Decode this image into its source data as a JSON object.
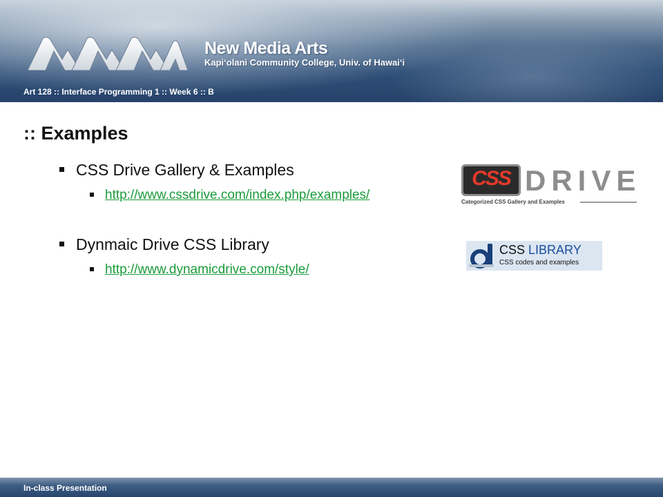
{
  "header": {
    "brand_title": "New Media Arts",
    "brand_subtitle": "Kapi‘olani Community College, Univ. of Hawai‘i",
    "course_line": "Art 128 :: Interface Programming 1 :: Week 6 :: B"
  },
  "slide": {
    "title": ":: Examples",
    "items": [
      {
        "label": "CSS Drive Gallery & Examples",
        "link": "http://www.cssdrive.com/index.php/examples/"
      },
      {
        "label": "Dynmaic Drive CSS Library",
        "link": "http://www.dynamicdrive.com/style/"
      }
    ]
  },
  "logos": {
    "cssdrive": {
      "emblem": "CSS",
      "word": "DRIVE",
      "tagline": "Categorized CSS Gallery and Examples"
    },
    "csslibrary": {
      "word1": "CSS",
      "word2": "LIBRARY",
      "tagline": "CSS codes and examples"
    }
  },
  "footer": {
    "text": "In-class Presentation"
  },
  "colors": {
    "link": "#1a9b3a",
    "header_dark": "#25426a",
    "emblem_red": "#e23a2a"
  }
}
